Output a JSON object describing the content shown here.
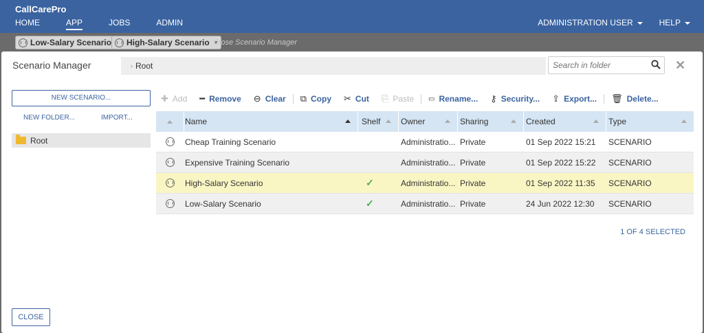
{
  "app": {
    "brand": "CallCarePro",
    "nav": [
      "HOME",
      "APP",
      "JOBS",
      "ADMIN"
    ],
    "active_nav": "APP",
    "user_menu": "ADMINISTRATION USER",
    "help_menu": "HELP"
  },
  "scenario_tabs": {
    "items": [
      "Low-Salary Scenario",
      "High-Salary Scenario"
    ],
    "close_manager": "Close Scenario Manager"
  },
  "dialog": {
    "title": "Scenario Manager",
    "breadcrumb": "Root",
    "search_placeholder": "Search in folder",
    "new_scenario": "NEW SCENARIO...",
    "new_folder": "NEW FOLDER...",
    "import": "IMPORT...",
    "tree_root": "Root",
    "toolbar": {
      "add": "Add",
      "remove": "Remove",
      "clear": "Clear",
      "copy": "Copy",
      "cut": "Cut",
      "paste": "Paste",
      "rename": "Rename...",
      "security": "Security...",
      "export": "Export...",
      "delete": "Delete..."
    },
    "columns": {
      "name": "Name",
      "shelf": "Shelf",
      "owner": "Owner",
      "sharing": "Sharing",
      "created": "Created",
      "type": "Type"
    },
    "rows": [
      {
        "name": "Cheap Training Scenario",
        "shelf": false,
        "owner": "Administratio...",
        "sharing": "Private",
        "created": "01 Sep 2022 15:21",
        "type": "SCENARIO"
      },
      {
        "name": "Expensive Training Scenario",
        "shelf": false,
        "owner": "Administratio...",
        "sharing": "Private",
        "created": "01 Sep 2022 15:22",
        "type": "SCENARIO"
      },
      {
        "name": "High-Salary Scenario",
        "shelf": true,
        "owner": "Administratio...",
        "sharing": "Private",
        "created": "01 Sep 2022 11:35",
        "type": "SCENARIO"
      },
      {
        "name": "Low-Salary Scenario",
        "shelf": true,
        "owner": "Administratio...",
        "sharing": "Private",
        "created": "24 Jun 2022 12:30",
        "type": "SCENARIO"
      }
    ],
    "selection_count": "1 OF 4 SELECTED",
    "close": "CLOSE"
  }
}
